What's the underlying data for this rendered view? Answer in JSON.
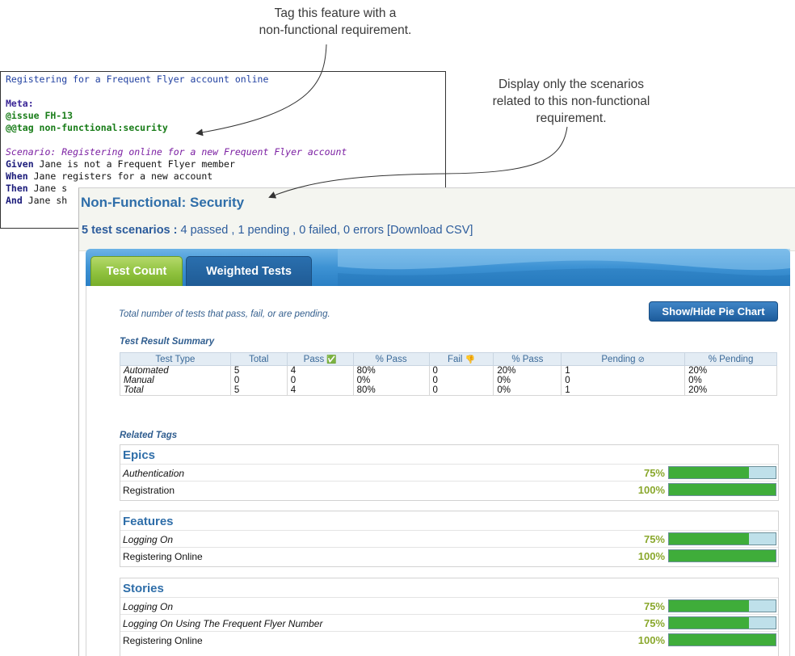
{
  "callouts": {
    "tag_feature": "Tag this feature with a\nnon-functional requirement.",
    "display_only": "Display only the scenarios\nrelated to this non-functional\nrequirement."
  },
  "feature_file": {
    "lines": [
      {
        "text": "Registering for a Frequent Flyer account online",
        "style": "title"
      },
      {
        "text": "",
        "style": "text"
      },
      {
        "text": "Meta:",
        "style": "meta"
      },
      {
        "text": "@issue FH-13",
        "style": "green"
      },
      {
        "text": "@@tag non-functional:security",
        "style": "green"
      },
      {
        "text": "",
        "style": "text"
      },
      {
        "text": "Scenario: Registering online for a new Frequent Flyer account",
        "style": "scenario"
      },
      {
        "keyword": "Given",
        "text": " Jane is not a Frequent Flyer member"
      },
      {
        "keyword": "When",
        "text": " Jane registers for a new account"
      },
      {
        "keyword": "Then",
        "text": " Jane s"
      },
      {
        "keyword": "And",
        "text": " Jane sh"
      }
    ]
  },
  "report": {
    "title": "Non-Functional: Security",
    "summary": {
      "count_label": "5 test scenarios",
      "separator": " : ",
      "details": "4 passed , 1 pending , 0 failed, 0 errors",
      "download_link": "[Download CSV]"
    },
    "tabs": [
      {
        "label": "Test Count",
        "active": true
      },
      {
        "label": "Weighted Tests",
        "active": false
      }
    ],
    "description": "Total number of tests that pass, fail, or are pending.",
    "pie_toggle_label": "Show/Hide Pie Chart",
    "summary_heading": "Test Result Summary",
    "summary_table": {
      "headers": [
        "Test Type",
        "Total",
        "Pass",
        "% Pass",
        "Fail",
        "% Pass",
        "Pending",
        "% Pending"
      ],
      "header_icons": {
        "pass": "✅",
        "fail": "👎",
        "pending": "⊘"
      },
      "rows": [
        [
          "Automated",
          "5",
          "4",
          "80%",
          "0",
          "20%",
          "1",
          "20%"
        ],
        [
          "Manual",
          "0",
          "0",
          "0%",
          "0",
          "0%",
          "0",
          "0%"
        ],
        [
          "Total",
          "5",
          "4",
          "80%",
          "0",
          "0%",
          "1",
          "20%"
        ]
      ]
    },
    "tags_heading": "Related Tags",
    "tag_groups": [
      {
        "title": "Epics",
        "rows": [
          {
            "name": "Authentication",
            "percent": "75%",
            "fraction": 0.75,
            "italic": true
          },
          {
            "name": "Registration",
            "percent": "100%",
            "fraction": 1.0,
            "italic": false
          }
        ]
      },
      {
        "title": "Features",
        "rows": [
          {
            "name": "Logging On",
            "percent": "75%",
            "fraction": 0.75,
            "italic": true
          },
          {
            "name": "Registering Online",
            "percent": "100%",
            "fraction": 1.0,
            "italic": false
          }
        ]
      },
      {
        "title": "Stories",
        "rows": [
          {
            "name": "Logging On",
            "percent": "75%",
            "fraction": 0.75,
            "italic": true
          },
          {
            "name": "Logging On Using The Frequent Flyer Number",
            "percent": "75%",
            "fraction": 0.75,
            "italic": true
          },
          {
            "name": "Registering Online",
            "percent": "100%",
            "fraction": 1.0,
            "italic": false
          }
        ]
      }
    ]
  },
  "colors": {
    "title_blue": "#2f6ea9",
    "pass_green": "#3fad3a",
    "pending_bar": "#bfe0ea",
    "percent_text": "#8aa82d"
  }
}
